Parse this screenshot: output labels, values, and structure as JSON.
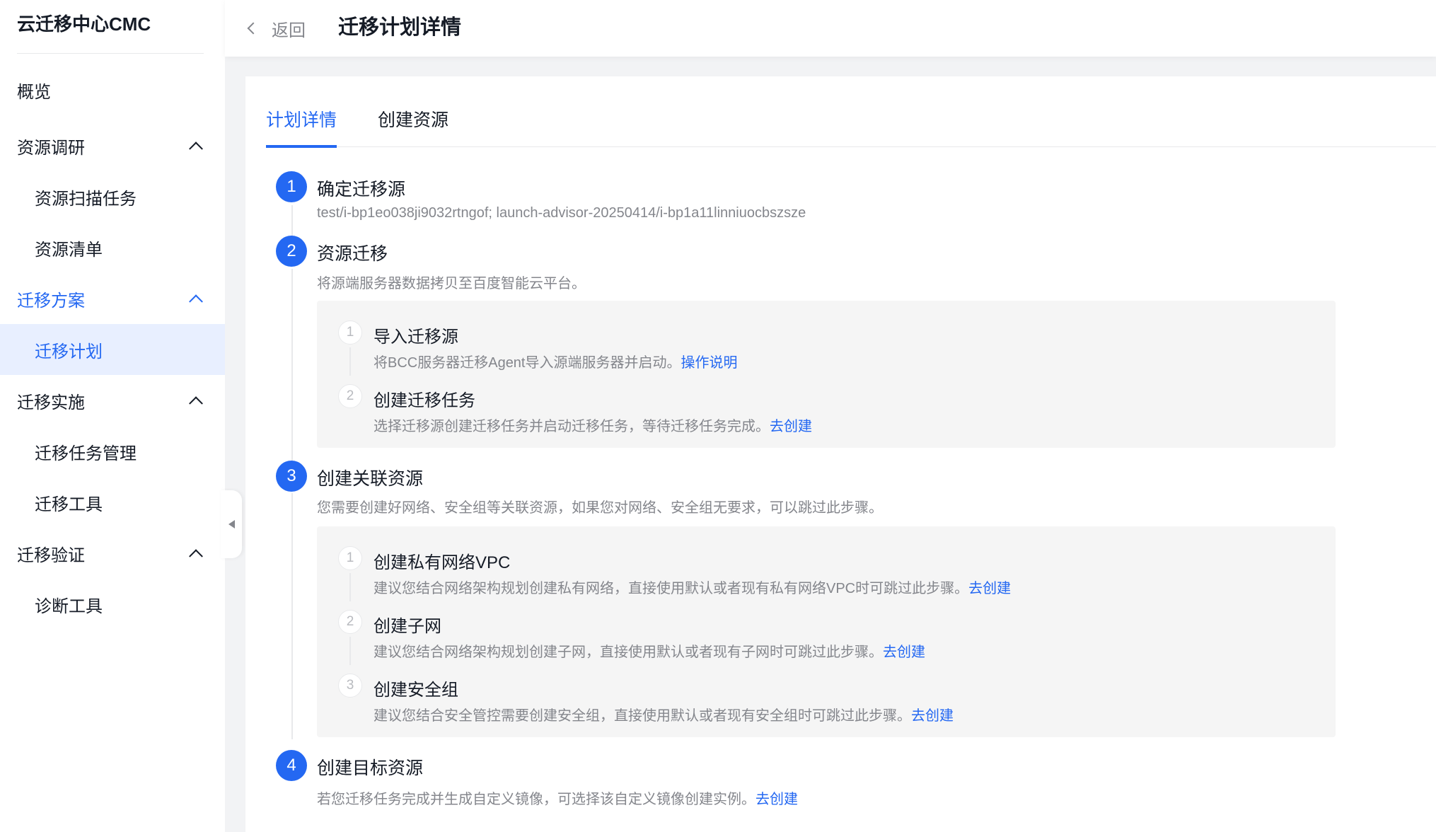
{
  "app": {
    "title": "云迁移中心CMC"
  },
  "sidebar": {
    "items": [
      {
        "label": "概览"
      },
      {
        "label": "资源调研"
      },
      {
        "label": "资源扫描任务"
      },
      {
        "label": "资源清单"
      },
      {
        "label": "迁移方案"
      },
      {
        "label": "迁移计划"
      },
      {
        "label": "迁移实施"
      },
      {
        "label": "迁移任务管理"
      },
      {
        "label": "迁移工具"
      },
      {
        "label": "迁移验证"
      },
      {
        "label": "诊断工具"
      }
    ]
  },
  "header": {
    "back_label": "返回",
    "title": "迁移计划详情"
  },
  "tabs": [
    {
      "label": "计划详情",
      "active": true
    },
    {
      "label": "创建资源",
      "active": false
    }
  ],
  "steps": [
    {
      "number": "1",
      "title": "确定迁移源",
      "desc": "test/i-bp1eo038ji9032rtngof; launch-advisor-20250414/i-bp1a11linniuocbszsze"
    },
    {
      "number": "2",
      "title": "资源迁移",
      "desc": "将源端服务器数据拷贝至百度智能云平台。",
      "substeps": [
        {
          "number": "1",
          "title": "导入迁移源",
          "desc": "将BCC服务器迁移Agent导入源端服务器并启动。",
          "link": "操作说明"
        },
        {
          "number": "2",
          "title": "创建迁移任务",
          "desc": "选择迁移源创建迁移任务并启动迁移任务，等待迁移任务完成。",
          "link": "去创建"
        }
      ]
    },
    {
      "number": "3",
      "title": "创建关联资源",
      "desc": "您需要创建好网络、安全组等关联资源，如果您对网络、安全组无要求，可以跳过此步骤。",
      "substeps": [
        {
          "number": "1",
          "title": "创建私有网络VPC",
          "desc": "建议您结合网络架构规划创建私有网络，直接使用默认或者现有私有网络VPC时可跳过此步骤。",
          "link": "去创建"
        },
        {
          "number": "2",
          "title": "创建子网",
          "desc": "建议您结合网络架构规划创建子网，直接使用默认或者现有子网时可跳过此步骤。",
          "link": "去创建"
        },
        {
          "number": "3",
          "title": "创建安全组",
          "desc": "建议您结合安全管控需要创建安全组，直接使用默认或者现有安全组时可跳过此步骤。",
          "link": "去创建"
        }
      ]
    },
    {
      "number": "4",
      "title": "创建目标资源",
      "desc": "若您迁移任务完成并生成自定义镜像，可选择该自定义镜像创建实例。",
      "link": "去创建"
    }
  ],
  "colors": {
    "accent": "#2468f2",
    "text": "#151b26",
    "muted": "#84868c",
    "active_bg": "#e8efff"
  }
}
